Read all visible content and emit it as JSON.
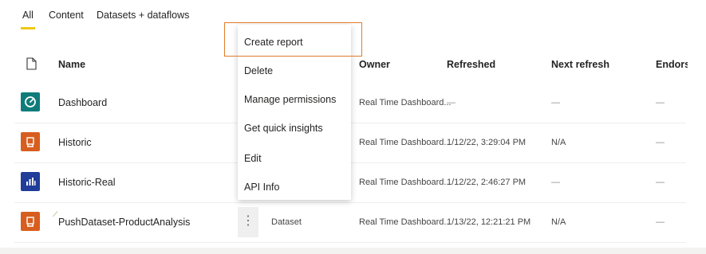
{
  "tabs": [
    "All",
    "Content",
    "Datasets + dataflows"
  ],
  "columns": {
    "type_icon": "file-icon",
    "name": "Name",
    "owner": "Owner",
    "refreshed": "Refreshed",
    "next_refresh": "Next refresh",
    "endorsement": "Endorse"
  },
  "rows": [
    {
      "name": "Dashboard",
      "icon": "dashboard-icon",
      "icon_color": "#0e7c7b",
      "type": "",
      "owner": "Real Time Dashboard...",
      "refreshed": "—",
      "next_refresh": "—",
      "endorsement": "—"
    },
    {
      "name": "Historic",
      "icon": "dataset-icon",
      "icon_color": "#d75e1f",
      "type": "",
      "owner": "Real Time Dashboard...",
      "refreshed": "1/12/22, 3:29:04 PM",
      "next_refresh": "N/A",
      "endorsement": "—"
    },
    {
      "name": "Historic-Real",
      "icon": "report-icon",
      "icon_color": "#1f3d99",
      "type": "",
      "owner": "Real Time Dashboard...",
      "refreshed": "1/12/22, 2:46:27 PM",
      "next_refresh": "—",
      "endorsement": "—"
    },
    {
      "name": "PushDataset-ProductAnalysis",
      "icon": "dataset-icon",
      "icon_color": "#d75e1f",
      "type": "Dataset",
      "owner": "Real Time Dashboard...",
      "refreshed": "1/13/22, 12:21:21 PM",
      "next_refresh": "N/A",
      "endorsement": "—"
    }
  ],
  "more_options_glyph": "⋮",
  "context_menu": [
    "Create report",
    "Delete",
    "Manage permissions",
    "Get quick insights",
    "Edit",
    "API Info"
  ],
  "colors": {
    "tab_underline": "#f2c811",
    "highlight_border": "#e07b2a"
  }
}
